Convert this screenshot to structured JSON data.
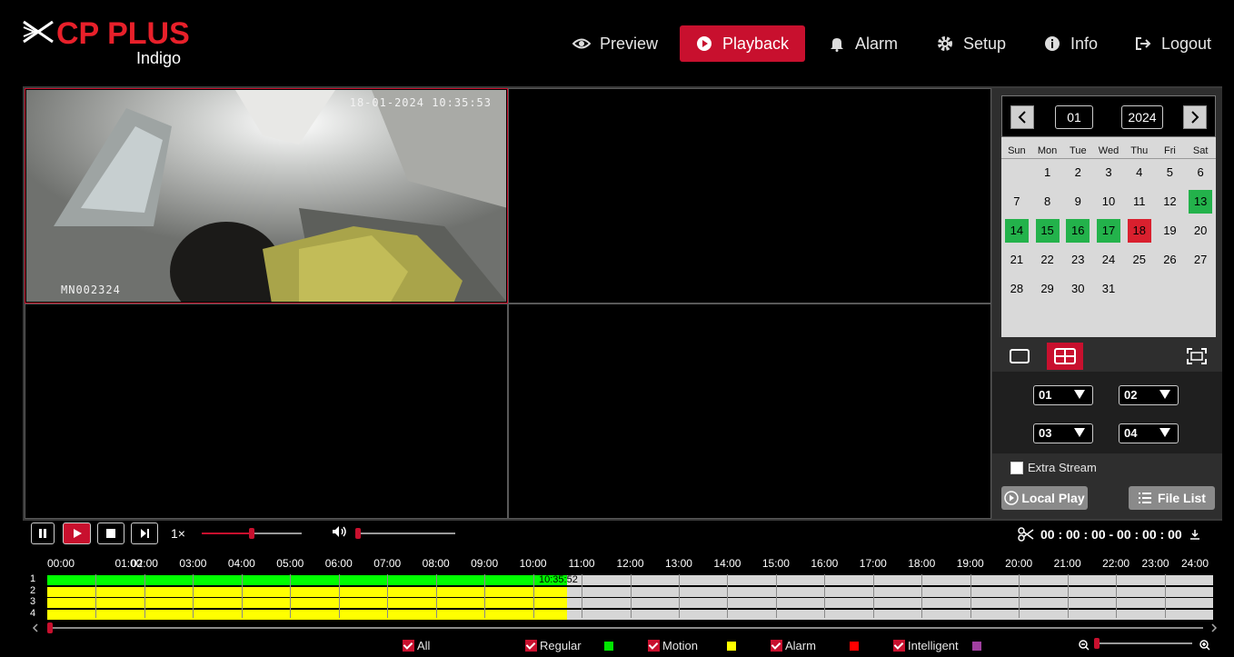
{
  "brand": {
    "name": "CP PLUS",
    "sub": "Indigo"
  },
  "nav": {
    "preview": "Preview",
    "playback": "Playback",
    "alarm": "Alarm",
    "setup": "Setup",
    "info": "Info",
    "logout": "Logout"
  },
  "camera": {
    "timestamp": "18-01-2024 10:35:53",
    "name": "MN002324"
  },
  "calendar": {
    "month": "01",
    "year": "2024",
    "weekdays": [
      "Sun",
      "Mon",
      "Tue",
      "Wed",
      "Thu",
      "Fri",
      "Sat"
    ],
    "days": [
      "1",
      "2",
      "3",
      "4",
      "5",
      "6",
      "7",
      "8",
      "9",
      "10",
      "11",
      "12",
      "13",
      "14",
      "15",
      "16",
      "17",
      "18",
      "19",
      "20",
      "21",
      "22",
      "23",
      "24",
      "25",
      "26",
      "27",
      "28",
      "29",
      "30",
      "31"
    ],
    "recorded_days": [
      "13",
      "14",
      "15",
      "16",
      "17"
    ],
    "current_day": "18"
  },
  "channels": {
    "ch1": "01",
    "ch2": "02",
    "ch3": "03",
    "ch4": "04"
  },
  "extra_stream": "Extra Stream",
  "local_play": "Local Play",
  "file_list": "File List",
  "playback": {
    "speed": "1×",
    "clip_range": "00 : 00 : 00 - 00 : 00 : 00",
    "progress": 0.5,
    "volume": 0.0
  },
  "timeline": {
    "hours": [
      "00:00",
      "01:00",
      "02:00",
      "03:00",
      "04:00",
      "05:00",
      "06:00",
      "07:00",
      "08:00",
      "09:00",
      "10:00",
      "11:00",
      "12:00",
      "13:00",
      "14:00",
      "15:00",
      "16:00",
      "17:00",
      "18:00",
      "19:00",
      "20:00",
      "21:00",
      "22:00",
      "23:00",
      "24:00"
    ],
    "rows": [
      "1",
      "2",
      "3",
      "4"
    ],
    "current_time": "10:35:52",
    "record_end_hours": 10.7,
    "colors": {
      "motion": "#00ff00",
      "regular": "#ffff00"
    }
  },
  "legend": {
    "all": "All",
    "regular": "Regular",
    "motion": "Motion",
    "alarm": "Alarm",
    "intelligent": "Intelligent",
    "colors": {
      "regular": "#00e600",
      "motion": "#ffff00",
      "alarm": "#ff0000",
      "intelligent": "#a040a0"
    }
  },
  "accent": "#c8102e"
}
